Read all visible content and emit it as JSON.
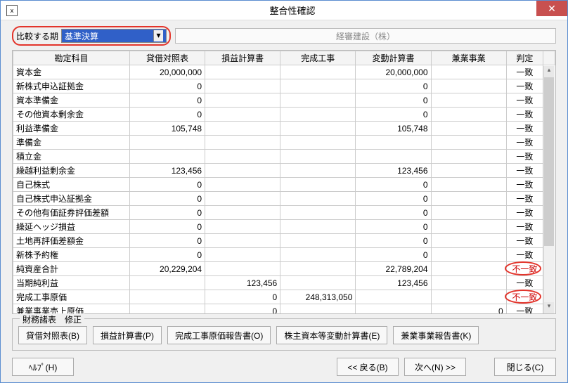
{
  "window": {
    "title": "整合性確認"
  },
  "toolbar": {
    "compare_label": "比較する期",
    "compare_value": "基準決算",
    "company_name": "経審建設（株）"
  },
  "grid": {
    "headers": {
      "name": "勘定科目",
      "tb": "貸借対照表",
      "pl": "損益計算書",
      "kj": "完成工事",
      "hk": "変動計算書",
      "kg": "兼業事業",
      "hantei": "判定"
    },
    "rows": [
      {
        "name": "資本金",
        "tb": "20,000,000",
        "pl": "",
        "kj": "",
        "hk": "20,000,000",
        "kg": "",
        "hantei": "一致"
      },
      {
        "name": "新株式申込証拠金",
        "tb": "0",
        "pl": "",
        "kj": "",
        "hk": "0",
        "kg": "",
        "hantei": "一致"
      },
      {
        "name": "資本準備金",
        "tb": "0",
        "pl": "",
        "kj": "",
        "hk": "0",
        "kg": "",
        "hantei": "一致"
      },
      {
        "name": "その他資本剰余金",
        "tb": "0",
        "pl": "",
        "kj": "",
        "hk": "0",
        "kg": "",
        "hantei": "一致"
      },
      {
        "name": "利益準備金",
        "tb": "105,748",
        "pl": "",
        "kj": "",
        "hk": "105,748",
        "kg": "",
        "hantei": "一致"
      },
      {
        "name": "準備金",
        "tb": "",
        "pl": "",
        "kj": "",
        "hk": "",
        "kg": "",
        "hantei": "一致"
      },
      {
        "name": "積立金",
        "tb": "",
        "pl": "",
        "kj": "",
        "hk": "",
        "kg": "",
        "hantei": "一致"
      },
      {
        "name": "繰越利益剰余金",
        "tb": "123,456",
        "pl": "",
        "kj": "",
        "hk": "123,456",
        "kg": "",
        "hantei": "一致"
      },
      {
        "name": "自己株式",
        "tb": "0",
        "pl": "",
        "kj": "",
        "hk": "0",
        "kg": "",
        "hantei": "一致"
      },
      {
        "name": "自己株式申込証拠金",
        "tb": "0",
        "pl": "",
        "kj": "",
        "hk": "0",
        "kg": "",
        "hantei": "一致"
      },
      {
        "name": "その他有価証券評価差額",
        "tb": "0",
        "pl": "",
        "kj": "",
        "hk": "0",
        "kg": "",
        "hantei": "一致"
      },
      {
        "name": "繰延ヘッジ損益",
        "tb": "0",
        "pl": "",
        "kj": "",
        "hk": "0",
        "kg": "",
        "hantei": "一致"
      },
      {
        "name": "土地再評価差額金",
        "tb": "0",
        "pl": "",
        "kj": "",
        "hk": "0",
        "kg": "",
        "hantei": "一致"
      },
      {
        "name": "新株予約権",
        "tb": "0",
        "pl": "",
        "kj": "",
        "hk": "0",
        "kg": "",
        "hantei": "一致"
      },
      {
        "name": "純資産合計",
        "tb": "20,229,204",
        "pl": "",
        "kj": "",
        "hk": "22,789,204",
        "kg": "",
        "hantei": "不一致",
        "mismatch": true
      },
      {
        "name": "当期純利益",
        "tb": "",
        "pl": "123,456",
        "kj": "",
        "hk": "123,456",
        "kg": "",
        "hantei": "一致"
      },
      {
        "name": "完成工事原価",
        "tb": "",
        "pl": "0",
        "kj": "248,313,050",
        "hk": "",
        "kg": "",
        "hantei": "不一致",
        "mismatch": true
      },
      {
        "name": "兼業事業売上原価",
        "tb": "",
        "pl": "0",
        "kj": "",
        "hk": "",
        "kg": "0",
        "hantei": "一致"
      }
    ]
  },
  "group": {
    "label": "財務諸表　修正",
    "btn_tb": "貸借対照表(B)",
    "btn_pl": "損益計算書(P)",
    "btn_kj": "完成工事原価報告書(O)",
    "btn_hk": "株主資本等変動計算書(E)",
    "btn_kg": "兼業事業報告書(K)"
  },
  "nav": {
    "help": "ﾍﾙﾌﾟ(H)",
    "back": "<<  戻る(B)",
    "next": "次へ(N)  >>",
    "close": "閉じる(C)"
  }
}
